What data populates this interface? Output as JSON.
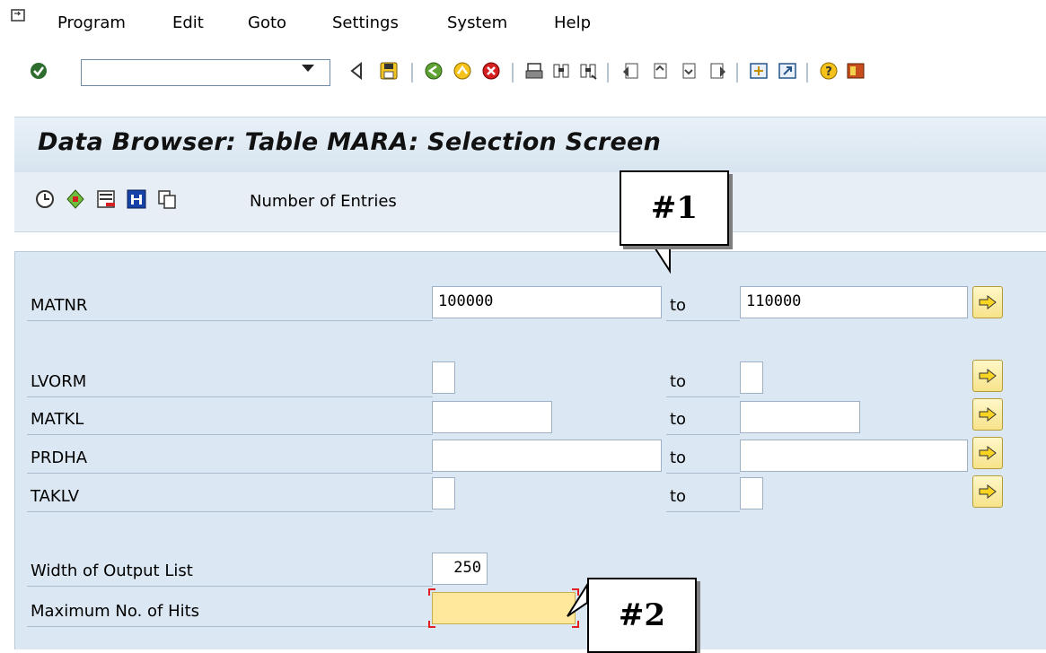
{
  "menu": {
    "items": [
      {
        "label": "Program"
      },
      {
        "label": "Edit"
      },
      {
        "label": "Goto"
      },
      {
        "label": "Settings"
      },
      {
        "label": "System"
      },
      {
        "label": "Help"
      }
    ]
  },
  "toolbar": {
    "command_field_value": ""
  },
  "title": "Data Browser: Table MARA: Selection Screen",
  "app_toolbar": {
    "number_of_entries_label": "Number of Entries"
  },
  "fields": [
    {
      "name": "MATNR",
      "from": "100000",
      "to_label": "to",
      "to": "110000"
    },
    {
      "name": "LVORM",
      "from": "",
      "to_label": "to",
      "to": ""
    },
    {
      "name": "MATKL",
      "from": "",
      "to_label": "to",
      "to": ""
    },
    {
      "name": "PRDHA",
      "from": "",
      "to_label": "to",
      "to": ""
    },
    {
      "name": "TAKLV",
      "from": "",
      "to_label": "to",
      "to": ""
    }
  ],
  "output": {
    "width_label": "Width of Output List",
    "width_value": "250",
    "max_hits_label": "Maximum No. of Hits",
    "max_hits_value": ""
  },
  "callouts": {
    "one": "#1",
    "two": "#2"
  },
  "colors": {
    "title_bg": "#dfe9f3",
    "panel_bg": "#dbe7f2",
    "arrow_button": "#f7e38a",
    "highlight_field": "#ffe79b"
  }
}
